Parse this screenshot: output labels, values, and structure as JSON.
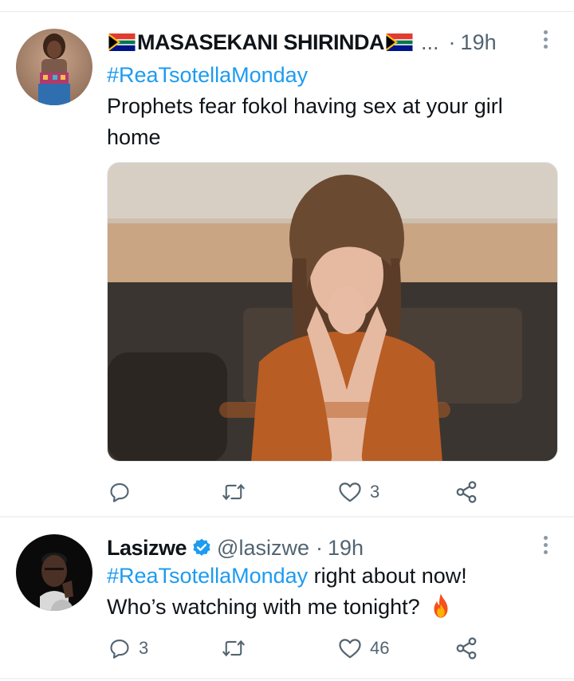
{
  "tweets": [
    {
      "author": {
        "name": "MASASEKANI SHIRINDA",
        "truncation": "...",
        "flag_icon": "south-africa-flag-emoji",
        "avatar": "user-avatar-photo"
      },
      "separator": "·",
      "time": "19h",
      "text": {
        "hashtag": "#ReaTsotellaMonday",
        "body": "Prophets fear fokol having sex at your girl home"
      },
      "media": {
        "kind": "photo",
        "subject": "woman-in-orange-shirt-hands-clasped"
      },
      "actions": {
        "reply_count": "",
        "retweet_count": "",
        "like_count": "3"
      }
    },
    {
      "author": {
        "name": "Lasizwe",
        "verified": true,
        "handle": "@lasizwe",
        "avatar": "user-avatar-photo"
      },
      "separator": "·",
      "time": "19h",
      "text": {
        "hashtag": "#ReaTsotellaMonday",
        "after_hashtag": " right about now!",
        "line2": "Who’s watching with me tonight?",
        "emoji": "fire-emoji"
      },
      "actions": {
        "reply_count": "3",
        "retweet_count": "",
        "like_count": "46"
      }
    }
  ],
  "colors": {
    "link": "#1d9bf0",
    "text": "#0f1419",
    "muted": "#536471",
    "verified": "#1d9bf0",
    "divider": "#eff3f4"
  }
}
